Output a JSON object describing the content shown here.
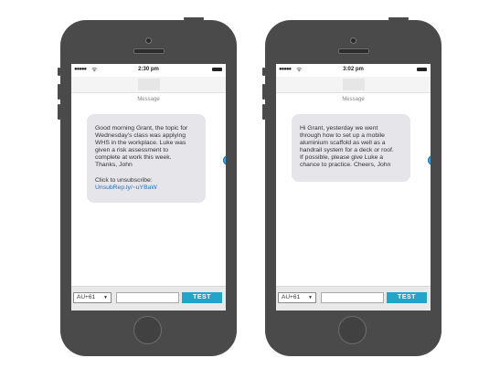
{
  "phones": [
    {
      "time": "2:30 pm",
      "title": "Message",
      "message_lines": [
        "Good morning Grant, the topic for",
        "Wednesday's class was applying",
        "WHS in the workplace. Luke was",
        "given a risk assessment to",
        "complete at work this week.",
        "Thanks, John"
      ],
      "unsubscribe_text": "Click to unsubscribe:",
      "unsubscribe_link": "UnsubRep.ly/~uYBaW",
      "country_code": "AU+61",
      "test_label": "TEST"
    },
    {
      "time": "3:02 pm",
      "title": "Message",
      "message_lines": [
        "Hi Grant, yesterday we went",
        "through how to set up a mobile",
        "aluminium scaffold as well as a",
        "handrail system for a deck or roof.",
        "If possible, please give Luke a",
        "chance to practice. Cheers, John"
      ],
      "country_code": "AU+61",
      "test_label": "TEST"
    }
  ],
  "colors": {
    "phone_body": "#4a4a4a",
    "bubble": "#e5e5ea",
    "test_button": "#21a5c9",
    "play_icon": "#3ea8d2",
    "link": "#1a73c8"
  },
  "icons": {
    "signal": "signal-dots-icon",
    "wifi": "wifi-icon",
    "battery": "battery-icon",
    "send": "play-icon",
    "dropdown": "chevron-down-icon"
  }
}
